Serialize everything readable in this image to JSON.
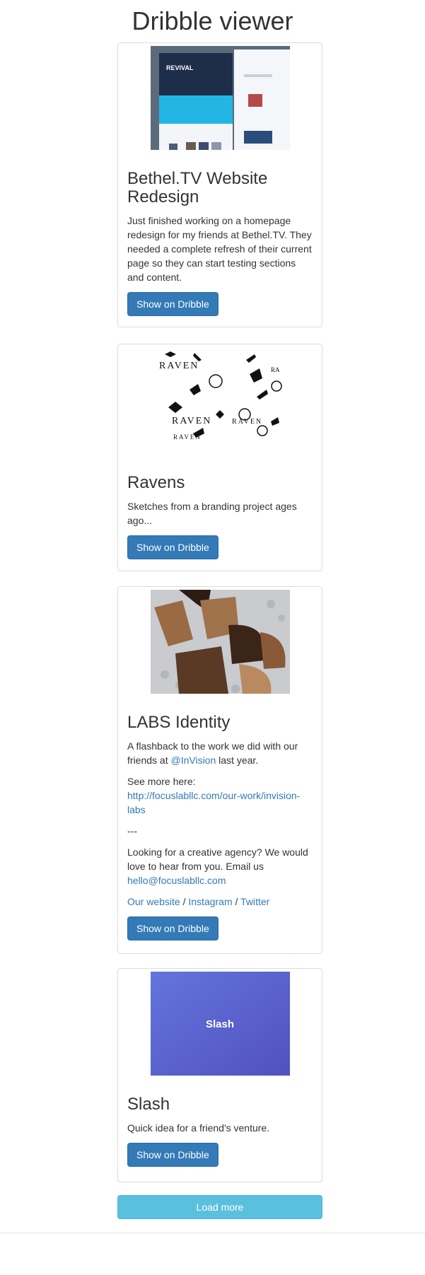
{
  "page": {
    "title": "Dribble viewer"
  },
  "shots": [
    {
      "title": "Bethel.TV Website Redesign",
      "paragraphs": [
        "Just finished working on a homepage redesign for my friends at Bethel.TV. They needed a complete refresh of their current page so they can start testing sections and content."
      ],
      "thumb_text": "REVIVAL",
      "button": "Show on Dribble"
    },
    {
      "title": "Ravens",
      "paragraphs": [
        "Sketches from a branding project ages ago..."
      ],
      "thumb_text": "RAVEN",
      "button": "Show on Dribble"
    },
    {
      "title": "LABS Identity",
      "p1_pre": "A flashback to the work we did with our friends at ",
      "p1_link": "@InVision",
      "p1_post": " last year.",
      "p2_pre": "See more here:",
      "p2_link": "http://focuslabllc.com/our-work/invision-labs",
      "sep": "---",
      "p3_pre": "Looking for a creative agency? We would love to hear from you. Email us",
      "p3_link": "hello@focuslabllc.com",
      "links": [
        "Our website",
        "Instagram",
        "Twitter"
      ],
      "link_sep": " / ",
      "button": "Show on Dribble"
    },
    {
      "title": "Slash",
      "paragraphs": [
        "Quick idea for a friend's venture."
      ],
      "thumb_text": "Slash",
      "button": "Show on Dribble"
    }
  ],
  "load_more": "Load more",
  "colors": {
    "primary": "#337ab7",
    "info": "#5bc0de",
    "slash_bg": "#5a6bd6"
  }
}
